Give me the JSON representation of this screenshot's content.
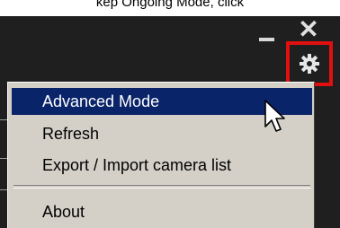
{
  "top_text": "kep Ongoing Mode, click",
  "window": {
    "close_glyph": "✕"
  },
  "icons": {
    "minimize": "minimize-icon",
    "close": "close-icon",
    "settings": "gear-icon",
    "cursor": "mouse-pointer-icon"
  },
  "colors": {
    "highlight": "#0a246a",
    "menu_bg": "#d4d0c8",
    "callout_border": "#e01010",
    "titlebar_bg": "#1f1f1f"
  },
  "menu": {
    "items": [
      {
        "label": "Advanced Mode",
        "highlighted": true
      },
      {
        "label": "Refresh"
      },
      {
        "label": "Export / Import camera list"
      },
      {
        "label": "About"
      }
    ]
  }
}
